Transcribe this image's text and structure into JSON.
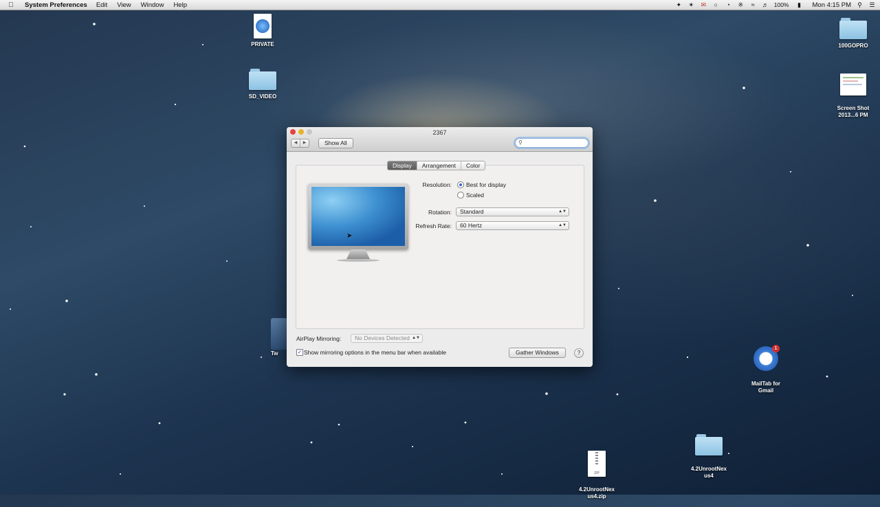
{
  "menubar": {
    "app_name": "System Preferences",
    "items": [
      "Edit",
      "View",
      "Window",
      "Help"
    ],
    "battery": "100%",
    "clock": "Mon 4:15 PM",
    "icons": [
      "apple-icon",
      "dropbox-icon",
      "twitter-icon",
      "gmail-icon",
      "skype-icon",
      "time-machine-icon",
      "bluetooth-icon",
      "wifi-icon",
      "volume-icon",
      "battery-icon",
      "spotlight-icon",
      "list-icon"
    ]
  },
  "desktop": {
    "icons": [
      {
        "label": "PRIVATE",
        "kind": "file"
      },
      {
        "label": "SD_VIDEO",
        "kind": "folder"
      },
      {
        "label": "100GOPRO",
        "kind": "folder"
      },
      {
        "label": "Screen Shot\n2013...6 PM",
        "kind": "image"
      },
      {
        "label": "MailTab for\nGmail",
        "kind": "app"
      },
      {
        "label": "4.2UnrootNex\nus4",
        "kind": "folder"
      },
      {
        "label": "4.2UnrootNex\nus4.zip",
        "kind": "zip"
      },
      {
        "label": "Tw",
        "kind": "app"
      }
    ]
  },
  "window": {
    "title": "2367",
    "show_all": "Show All",
    "search_placeholder": "",
    "tabs": [
      "Display",
      "Arrangement",
      "Color"
    ],
    "active_tab": "Display",
    "resolution_label": "Resolution:",
    "resolution_options": [
      "Best for display",
      "Scaled"
    ],
    "resolution_selected": "Best for display",
    "rotation_label": "Rotation:",
    "rotation_value": "Standard",
    "refresh_label": "Refresh Rate:",
    "refresh_value": "60 Hertz",
    "airplay_label": "AirPlay Mirroring:",
    "airplay_value": "No Devices Detected",
    "mirroring_checkbox": "Show mirroring options in the menu bar when available",
    "mirroring_checked": true,
    "gather_button": "Gather Windows",
    "help_button": "?"
  },
  "colors": {
    "accent": "#2d6ad1",
    "close": "#e2463f",
    "minimize": "#e8b22b"
  }
}
